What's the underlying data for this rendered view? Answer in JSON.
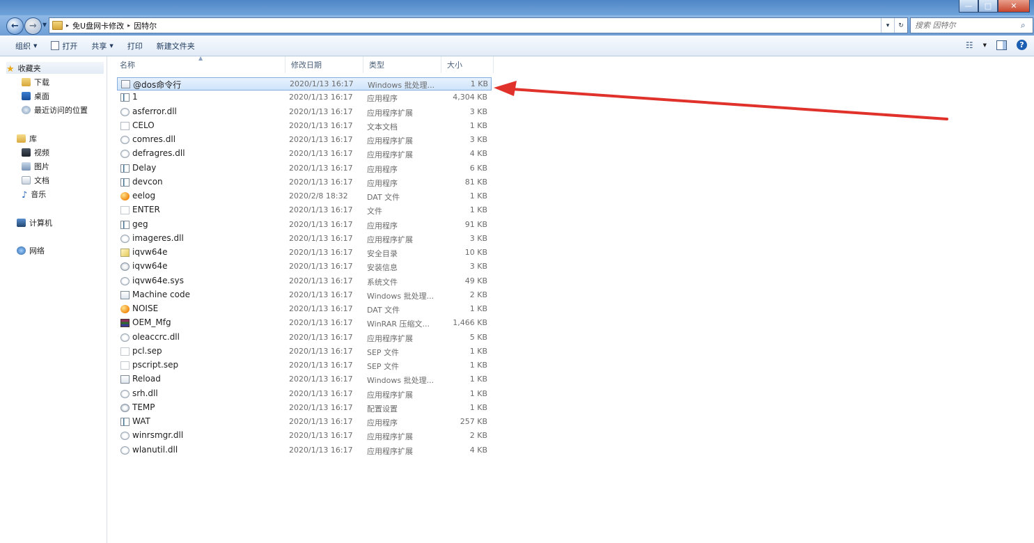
{
  "window": {
    "minimize_glyph": "—",
    "maximize_glyph": "□",
    "close_glyph": "✕"
  },
  "address": {
    "segments": [
      "免U盘网卡修改",
      "因特尔"
    ],
    "separator": "▸"
  },
  "search": {
    "placeholder": "搜索 因特尔"
  },
  "toolbar": {
    "organize": "组织",
    "open": "打开",
    "share": "共享",
    "print": "打印",
    "new_folder": "新建文件夹",
    "dropdown_glyph": "▼"
  },
  "nav": {
    "favorites": "收藏夹",
    "downloads": "下载",
    "desktop": "桌面",
    "recent": "最近访问的位置",
    "libraries": "库",
    "videos": "视频",
    "pictures": "图片",
    "documents": "文档",
    "music": "音乐",
    "computer": "计算机",
    "network": "网络"
  },
  "columns": {
    "name": "名称",
    "date": "修改日期",
    "type": "类型",
    "size": "大小"
  },
  "files": [
    {
      "name": "@dos命令行",
      "date": "2020/1/13 16:17",
      "type": "Windows 批处理...",
      "size": "1 KB",
      "icon": "bat-icon",
      "selected": true
    },
    {
      "name": "1",
      "date": "2020/1/13 16:17",
      "type": "应用程序",
      "size": "4,304 KB",
      "icon": "exe-icon"
    },
    {
      "name": "asferror.dll",
      "date": "2020/1/13 16:17",
      "type": "应用程序扩展",
      "size": "3 KB",
      "icon": "dll-icon"
    },
    {
      "name": "CELO",
      "date": "2020/1/13 16:17",
      "type": "文本文档",
      "size": "1 KB",
      "icon": "txt-icon"
    },
    {
      "name": "comres.dll",
      "date": "2020/1/13 16:17",
      "type": "应用程序扩展",
      "size": "3 KB",
      "icon": "dll-icon"
    },
    {
      "name": "defragres.dll",
      "date": "2020/1/13 16:17",
      "type": "应用程序扩展",
      "size": "4 KB",
      "icon": "dll-icon"
    },
    {
      "name": "Delay",
      "date": "2020/1/13 16:17",
      "type": "应用程序",
      "size": "6 KB",
      "icon": "exe-icon"
    },
    {
      "name": "devcon",
      "date": "2020/1/13 16:17",
      "type": "应用程序",
      "size": "81 KB",
      "icon": "exe-icon"
    },
    {
      "name": "eelog",
      "date": "2020/2/8 18:32",
      "type": "DAT 文件",
      "size": "1 KB",
      "icon": "dat-icon"
    },
    {
      "name": "ENTER",
      "date": "2020/1/13 16:17",
      "type": "文件",
      "size": "1 KB",
      "icon": "blank-file-icon"
    },
    {
      "name": "geg",
      "date": "2020/1/13 16:17",
      "type": "应用程序",
      "size": "91 KB",
      "icon": "exe-icon"
    },
    {
      "name": "imageres.dll",
      "date": "2020/1/13 16:17",
      "type": "应用程序扩展",
      "size": "3 KB",
      "icon": "dll-icon"
    },
    {
      "name": "iqvw64e",
      "date": "2020/1/13 16:17",
      "type": "安全目录",
      "size": "10 KB",
      "icon": "catalog-icon"
    },
    {
      "name": "iqvw64e",
      "date": "2020/1/13 16:17",
      "type": "安装信息",
      "size": "3 KB",
      "icon": "inf-icon"
    },
    {
      "name": "iqvw64e.sys",
      "date": "2020/1/13 16:17",
      "type": "系统文件",
      "size": "49 KB",
      "icon": "dll-icon"
    },
    {
      "name": "Machine code",
      "date": "2020/1/13 16:17",
      "type": "Windows 批处理...",
      "size": "2 KB",
      "icon": "bat-icon"
    },
    {
      "name": "NOISE",
      "date": "2020/1/13 16:17",
      "type": "DAT 文件",
      "size": "1 KB",
      "icon": "dat-icon"
    },
    {
      "name": "OEM_Mfg",
      "date": "2020/1/13 16:17",
      "type": "WinRAR 压缩文...",
      "size": "1,466 KB",
      "icon": "rar-icon"
    },
    {
      "name": "oleaccrc.dll",
      "date": "2020/1/13 16:17",
      "type": "应用程序扩展",
      "size": "5 KB",
      "icon": "dll-icon"
    },
    {
      "name": "pcl.sep",
      "date": "2020/1/13 16:17",
      "type": "SEP 文件",
      "size": "1 KB",
      "icon": "blank-file-icon"
    },
    {
      "name": "pscript.sep",
      "date": "2020/1/13 16:17",
      "type": "SEP 文件",
      "size": "1 KB",
      "icon": "blank-file-icon"
    },
    {
      "name": "Reload",
      "date": "2020/1/13 16:17",
      "type": "Windows 批处理...",
      "size": "1 KB",
      "icon": "bat-icon"
    },
    {
      "name": "srh.dll",
      "date": "2020/1/13 16:17",
      "type": "应用程序扩展",
      "size": "1 KB",
      "icon": "dll-icon"
    },
    {
      "name": "TEMP",
      "date": "2020/1/13 16:17",
      "type": "配置设置",
      "size": "1 KB",
      "icon": "ini-icon"
    },
    {
      "name": "WAT",
      "date": "2020/1/13 16:17",
      "type": "应用程序",
      "size": "257 KB",
      "icon": "exe-icon"
    },
    {
      "name": "winrsmgr.dll",
      "date": "2020/1/13 16:17",
      "type": "应用程序扩展",
      "size": "2 KB",
      "icon": "dll-icon"
    },
    {
      "name": "wlanutil.dll",
      "date": "2020/1/13 16:17",
      "type": "应用程序扩展",
      "size": "4 KB",
      "icon": "dll-icon"
    }
  ],
  "annotation": {
    "color": "#e0312b"
  }
}
